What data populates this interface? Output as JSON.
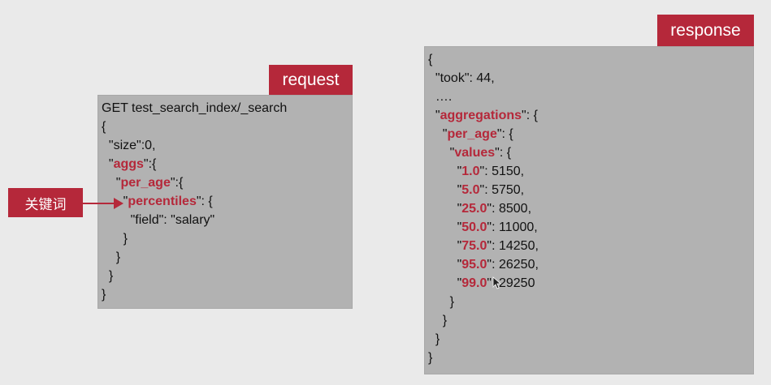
{
  "request": {
    "tag": "request",
    "lines": [
      "GET test_search_index/_search",
      "{",
      "  \"size\":0,",
      "  \"aggs\":{",
      "    \"per_age\":{",
      "      \"percentiles\": {",
      "        \"field\": \"salary\"",
      "      }",
      "    }",
      "  }",
      "}"
    ]
  },
  "response": {
    "tag": "response",
    "lines": [
      "{",
      "  \"took\": 44,",
      "  ….",
      "  \"aggregations\": {",
      "    \"per_age\": {",
      "      \"values\": {",
      "        \"1.0\": 5150,",
      "        \"5.0\": 5750,",
      "        \"25.0\": 8500,",
      "        \"50.0\": 11000,",
      "        \"75.0\": 14250,",
      "        \"95.0\": 26250,",
      "        \"99.0\": 29250",
      "      }",
      "    }",
      "  }",
      "}"
    ]
  },
  "annotation": {
    "label": "关键词"
  },
  "colors": {
    "accent": "#b5283a",
    "panel": "#b2b2b2",
    "background": "#eaeaea"
  }
}
